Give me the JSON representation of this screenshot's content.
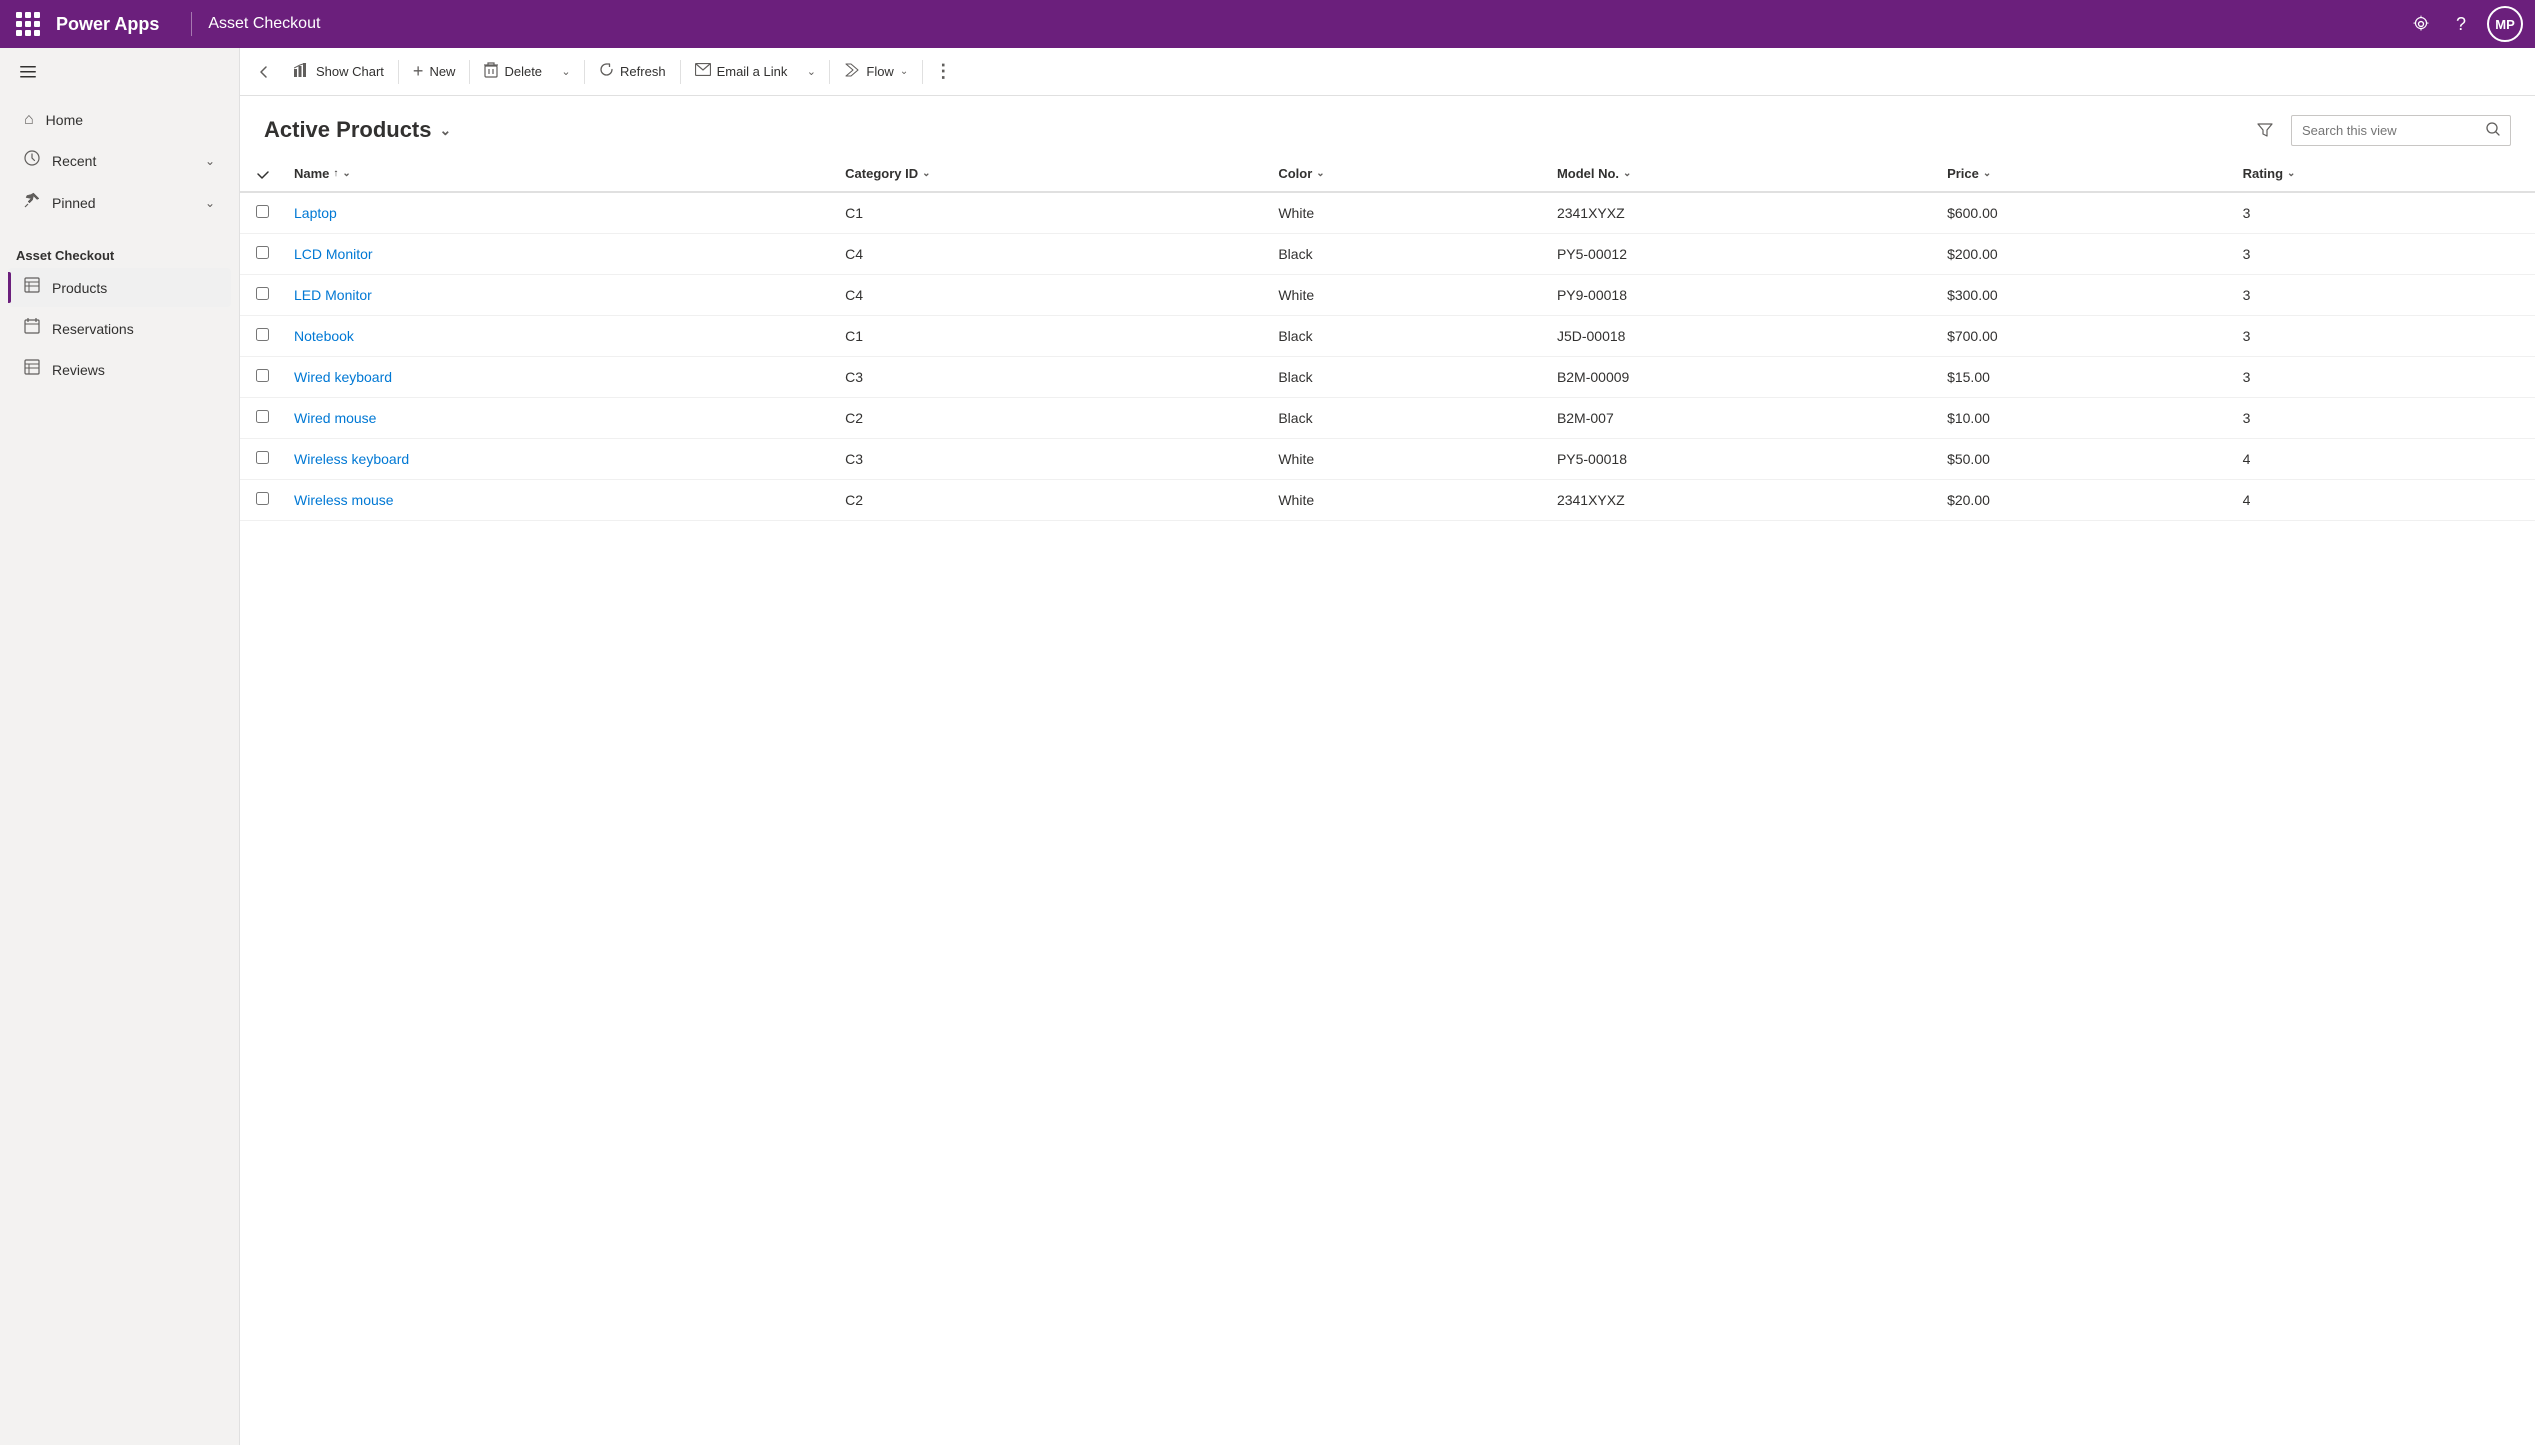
{
  "app": {
    "brand": "Power Apps",
    "title": "Asset Checkout"
  },
  "topbar": {
    "settings_label": "Settings",
    "help_label": "Help",
    "avatar_initials": "MP"
  },
  "sidebar": {
    "toggle_label": "Toggle navigation",
    "nav_items": [
      {
        "id": "home",
        "label": "Home",
        "icon": "⌂"
      },
      {
        "id": "recent",
        "label": "Recent",
        "icon": "🕐",
        "has_chevron": true
      },
      {
        "id": "pinned",
        "label": "Pinned",
        "icon": "📌",
        "has_chevron": true
      }
    ],
    "section_label": "Asset Checkout",
    "app_items": [
      {
        "id": "products",
        "label": "Products",
        "icon": "📋",
        "active": true
      },
      {
        "id": "reservations",
        "label": "Reservations",
        "icon": "📅",
        "active": false
      },
      {
        "id": "reviews",
        "label": "Reviews",
        "icon": "📋",
        "active": false
      }
    ]
  },
  "toolbar": {
    "back_tooltip": "Back",
    "show_chart_label": "Show Chart",
    "new_label": "New",
    "delete_label": "Delete",
    "refresh_label": "Refresh",
    "email_link_label": "Email a Link",
    "flow_label": "Flow",
    "more_label": "More"
  },
  "view": {
    "title": "Active Products",
    "search_placeholder": "Search this view"
  },
  "table": {
    "columns": [
      {
        "id": "name",
        "label": "Name",
        "sortable": true,
        "sort_dir": "asc"
      },
      {
        "id": "category_id",
        "label": "Category ID",
        "sortable": true
      },
      {
        "id": "color",
        "label": "Color",
        "sortable": true
      },
      {
        "id": "model_no",
        "label": "Model No.",
        "sortable": true
      },
      {
        "id": "price",
        "label": "Price",
        "sortable": true
      },
      {
        "id": "rating",
        "label": "Rating",
        "sortable": true
      }
    ],
    "rows": [
      {
        "name": "Laptop",
        "category_id": "C1",
        "color": "White",
        "model_no": "2341XYXZ",
        "price": "$600.00",
        "rating": "3"
      },
      {
        "name": "LCD Monitor",
        "category_id": "C4",
        "color": "Black",
        "model_no": "PY5-00012",
        "price": "$200.00",
        "rating": "3"
      },
      {
        "name": "LED Monitor",
        "category_id": "C4",
        "color": "White",
        "model_no": "PY9-00018",
        "price": "$300.00",
        "rating": "3"
      },
      {
        "name": "Notebook",
        "category_id": "C1",
        "color": "Black",
        "model_no": "J5D-00018",
        "price": "$700.00",
        "rating": "3"
      },
      {
        "name": "Wired keyboard",
        "category_id": "C3",
        "color": "Black",
        "model_no": "B2M-00009",
        "price": "$15.00",
        "rating": "3"
      },
      {
        "name": "Wired mouse",
        "category_id": "C2",
        "color": "Black",
        "model_no": "B2M-007",
        "price": "$10.00",
        "rating": "3"
      },
      {
        "name": "Wireless keyboard",
        "category_id": "C3",
        "color": "White",
        "model_no": "PY5-00018",
        "price": "$50.00",
        "rating": "4"
      },
      {
        "name": "Wireless mouse",
        "category_id": "C2",
        "color": "White",
        "model_no": "2341XYXZ",
        "price": "$20.00",
        "rating": "4"
      }
    ]
  },
  "colors": {
    "brand": "#6b1f7c",
    "link": "#0078d4"
  }
}
